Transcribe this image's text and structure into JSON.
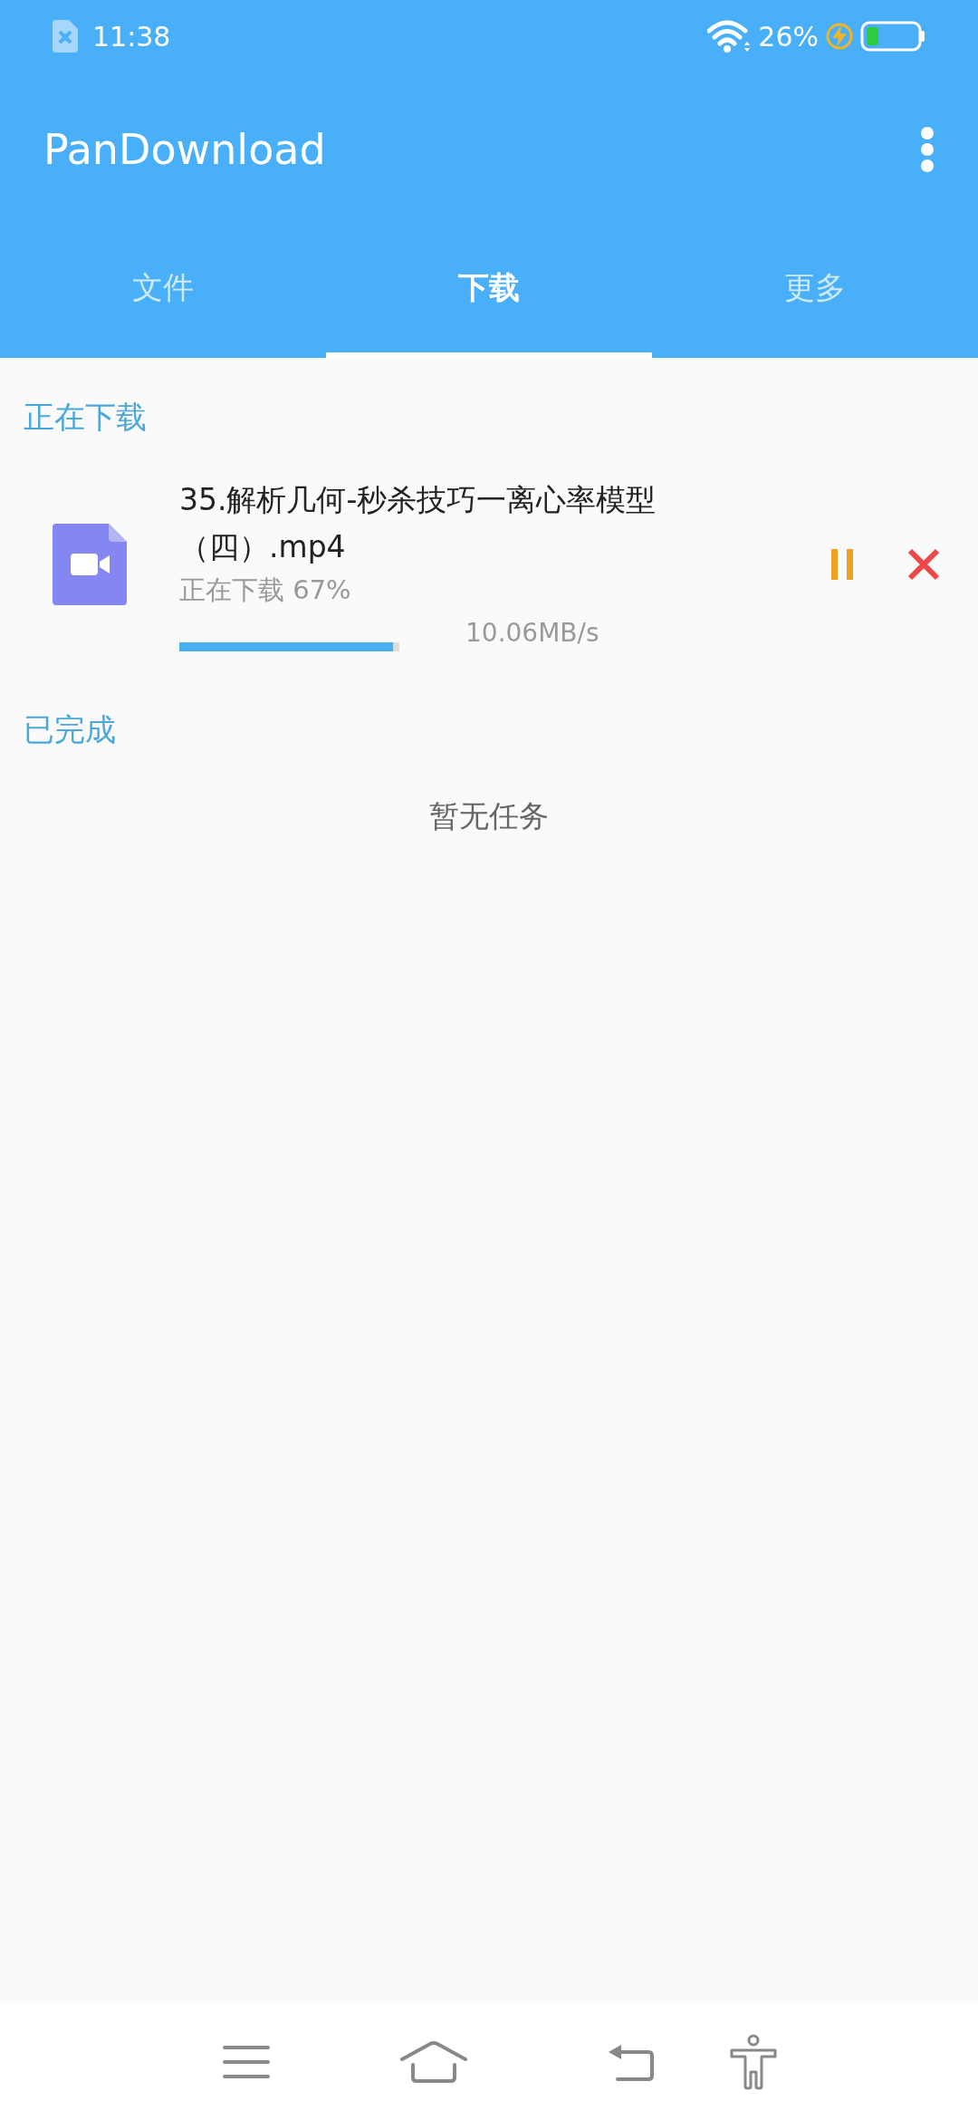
{
  "status_bar": {
    "time": "11:38",
    "battery": "26%",
    "charging": true
  },
  "toolbar": {
    "title": "PanDownload"
  },
  "tabs": [
    {
      "label": "文件",
      "selected": false
    },
    {
      "label": "下载",
      "selected": true
    },
    {
      "label": "更多",
      "selected": false
    }
  ],
  "downloading": {
    "title": "正在下载",
    "items": [
      {
        "name": "35.解析几何-秒杀技巧一离心率模型（四）.mp4",
        "status": "正在下载 67%",
        "level": 0.97,
        "speed": "10.06MB/s"
      }
    ]
  },
  "completed": {
    "title": "已完成",
    "empty_text": "暂无任务"
  }
}
